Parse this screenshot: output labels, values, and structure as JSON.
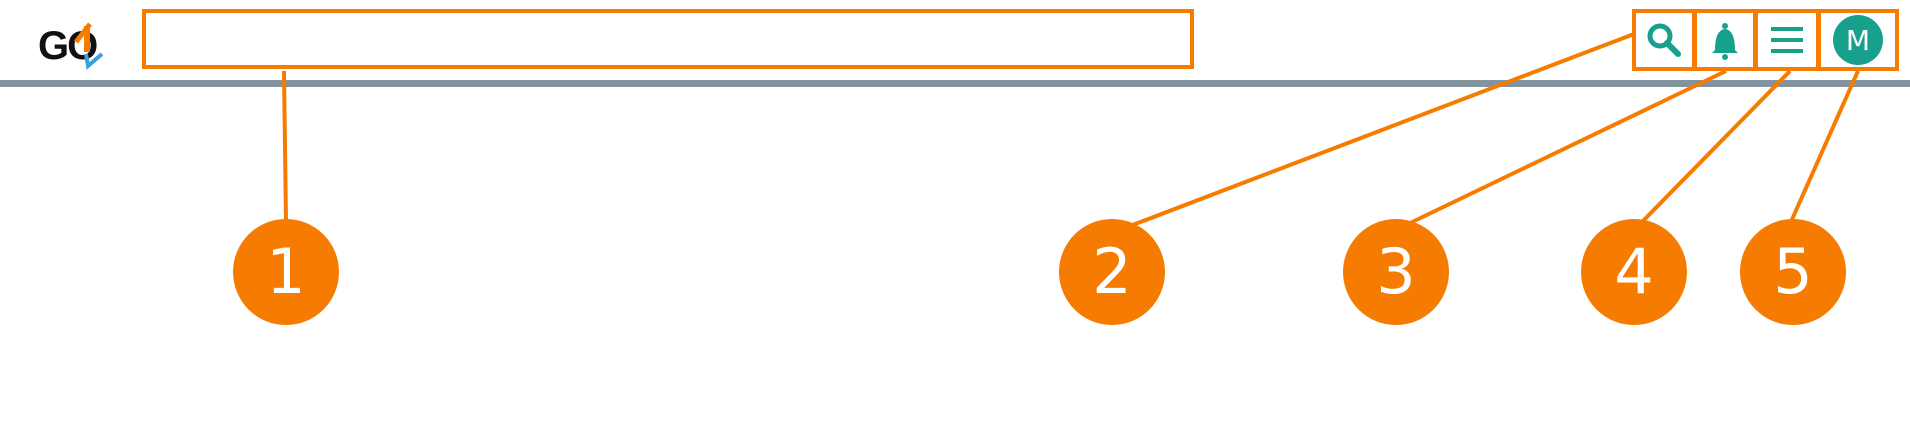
{
  "header": {
    "logo": {
      "text": "GO",
      "name": "go-logo"
    },
    "search": {
      "placeholder": "",
      "value": ""
    },
    "actions": [
      {
        "id": "search",
        "icon": "search-icon",
        "color": "#17a08c"
      },
      {
        "id": "notifications",
        "icon": "bell-icon",
        "color": "#17a08c"
      },
      {
        "id": "menu",
        "icon": "hamburger-menu-icon",
        "color": "#17a08c"
      },
      {
        "id": "account",
        "icon": "avatar",
        "initial": "M",
        "color": "#17a08c"
      }
    ]
  },
  "callouts": [
    {
      "label": "1",
      "target": "search-input"
    },
    {
      "label": "2",
      "target": "search-button"
    },
    {
      "label": "3",
      "target": "notifications-button"
    },
    {
      "label": "4",
      "target": "menu-button"
    },
    {
      "label": "5",
      "target": "account-avatar-button"
    }
  ],
  "colors": {
    "accent": "#f57c00",
    "teal": "#17a08c",
    "divider": "#8393a0"
  }
}
